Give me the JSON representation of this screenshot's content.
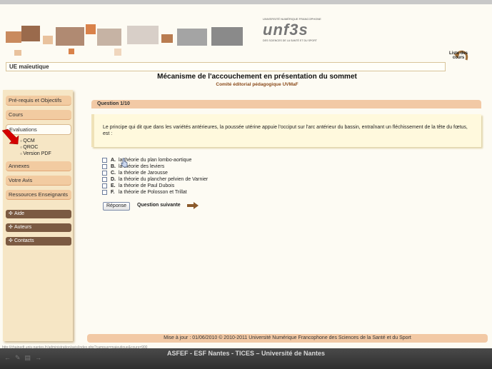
{
  "header": {
    "logo": {
      "top_text": "UNIVERSITÉ NUMÉRIQUE FRANCOPHONE",
      "main_text": "unf3s",
      "sub_text": "DES SCIENCES DE LA SANTÉ ET DU SPORT"
    },
    "liste_cours": "Liste des cours"
  },
  "module_bar": "UE maïeutique",
  "title": "Mécanisme de l'accouchement en présentation du sommet",
  "subtitle": "Comité éditorial pédagogique UVMaF",
  "sidebar": {
    "items": [
      {
        "label": "Pré-requis et Objectifs"
      },
      {
        "label": "Cours"
      },
      {
        "label": "Evaluations"
      },
      {
        "label": "Annexes"
      },
      {
        "label": "Votre Avis"
      },
      {
        "label": "Ressources Enseignants"
      }
    ],
    "sub_items": [
      "QCM",
      "QROC",
      "Version PDF"
    ],
    "dark_items": [
      {
        "label": "Aide"
      },
      {
        "label": "Auteurs"
      },
      {
        "label": "Contacts"
      }
    ]
  },
  "question": {
    "header": "Question 1/10",
    "text": "Le principe qui dit que dans les variétés antérieures, la poussée utérine appuie l'occiput sur l'arc antérieur du bassin, entraînant un fléchissement de la tête du fœtus, est :",
    "options": [
      {
        "letter": "A.",
        "text": "la théorie du plan lombo-aortique"
      },
      {
        "letter": "B.",
        "text": "la théorie des leviers"
      },
      {
        "letter": "C.",
        "text": "la théorie de Jarousse"
      },
      {
        "letter": "D.",
        "text": "la théorie du plancher pelvien de Varnier"
      },
      {
        "letter": "E.",
        "text": "la théorie de Paul Dubois"
      },
      {
        "letter": "F.",
        "text": "la théorie de Polosson et Trillat"
      }
    ],
    "reponse_label": "Réponse",
    "next_label": "Question suivante"
  },
  "footer": "Mise à jour : 01/06/2010 © 2010-2011 Université Numérique Francophone des Sciences de la Santé et du Sport",
  "status_url": "http://chainedt.univ-nantes.fr/administration/avis/index.php?campus=maieutique&cours=900",
  "bottom_caption": "ASFEF - ESF Nantes - TICES – Université de Nantes",
  "colors": {
    "accent": "#f2c9a5",
    "sidebar_bg": "#f6e6c5",
    "dark_button": "#7b5a42",
    "question_bg": "#fff9dd",
    "red_arrow": "#d40000"
  }
}
